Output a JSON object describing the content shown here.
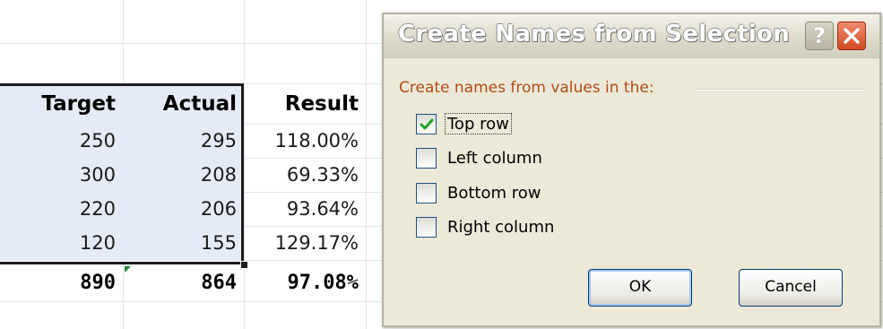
{
  "spreadsheet": {
    "headers": [
      "Target",
      "Actual",
      "Result"
    ],
    "rows": [
      [
        "250",
        "295",
        "118.00%"
      ],
      [
        "300",
        "208",
        "69.33%"
      ],
      [
        "220",
        "206",
        "93.64%"
      ],
      [
        "120",
        "155",
        "129.17%"
      ]
    ],
    "totals": [
      "890",
      "864",
      "97.08%"
    ],
    "selection_fill_color": "#e5ebf6",
    "error_indicator_color": "#1e8a3a"
  },
  "dialog": {
    "title": "Create Names from Selection",
    "help_glyph": "?",
    "group_label": "Create names from values in the:",
    "options": [
      {
        "label": "Top row",
        "checked": true
      },
      {
        "label": "Left column",
        "checked": false
      },
      {
        "label": "Bottom row",
        "checked": false
      },
      {
        "label": "Right column",
        "checked": false
      }
    ],
    "ok_label": "OK",
    "cancel_label": "Cancel",
    "label_color": "#b24b17",
    "check_color": "#21a121"
  }
}
